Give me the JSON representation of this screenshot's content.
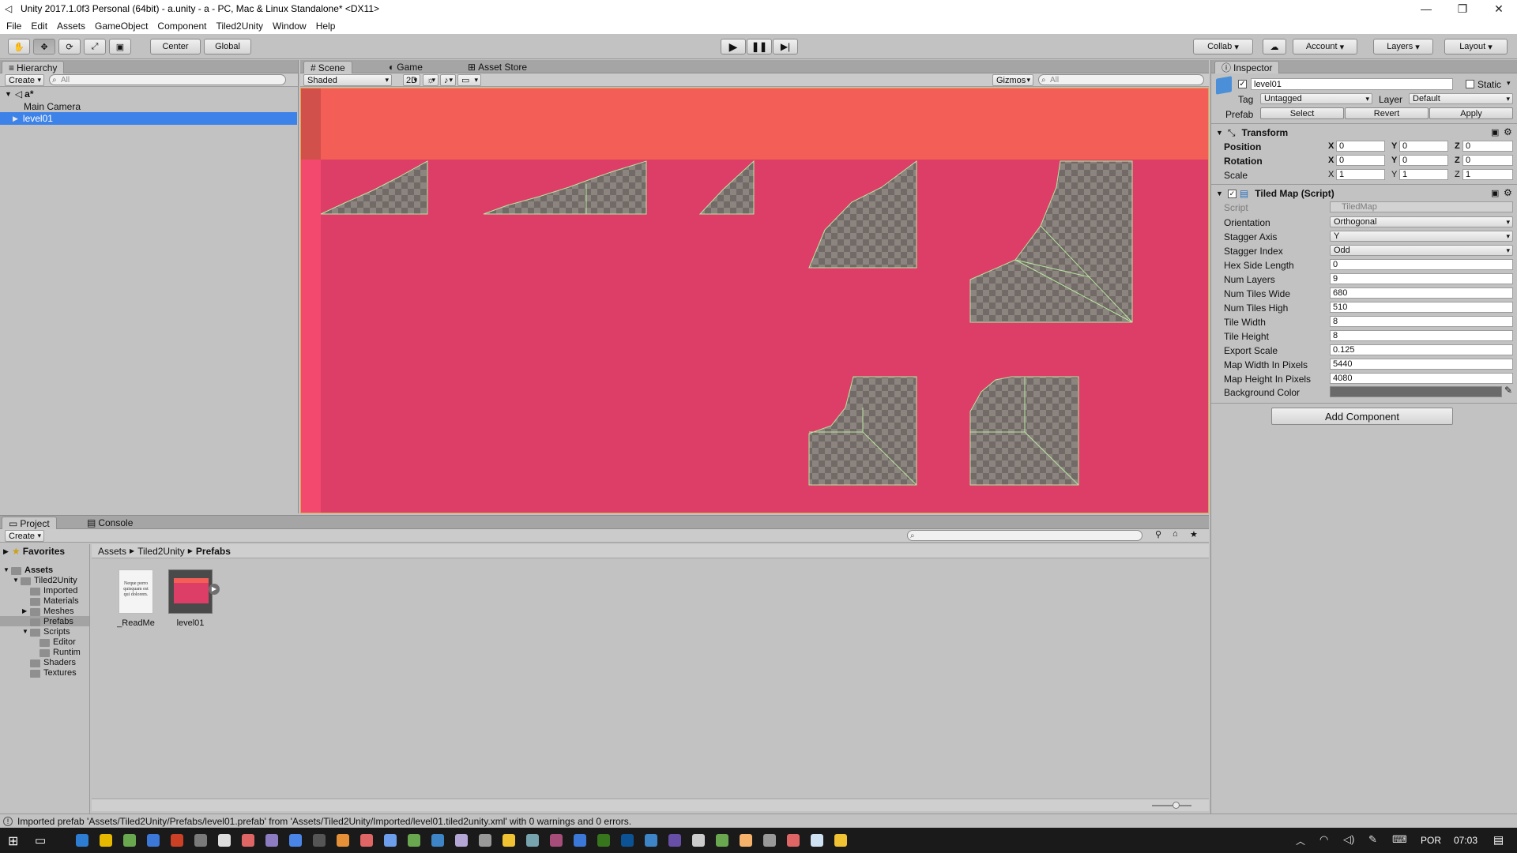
{
  "window": {
    "title": "Unity 2017.1.0f3 Personal (64bit) - a.unity - a - PC, Mac & Linux Standalone* <DX11>",
    "minimize": "—",
    "maximize": "❐",
    "close": "✕"
  },
  "menu": [
    "File",
    "Edit",
    "Assets",
    "GameObject",
    "Component",
    "Tiled2Unity",
    "Window",
    "Help"
  ],
  "toolbar": {
    "pivot": "Center",
    "space": "Global",
    "collab": "Collab",
    "account": "Account",
    "layers": "Layers",
    "layout": "Layout"
  },
  "hierarchy": {
    "tab": "Hierarchy",
    "create": "Create",
    "search_placeholder": "All",
    "scene": "a*",
    "items": [
      "Main Camera",
      "level01"
    ]
  },
  "scene": {
    "tabs": [
      "Scene",
      "Game",
      "Asset Store"
    ],
    "shading": "Shaded",
    "mode2d": "2D",
    "gizmos": "Gizmos",
    "search_placeholder": "All"
  },
  "inspector": {
    "tab": "Inspector",
    "object_name": "level01",
    "static_label": "Static",
    "tag_label": "Tag",
    "tag_value": "Untagged",
    "layer_label": "Layer",
    "layer_value": "Default",
    "prefab_label": "Prefab",
    "prefab_select": "Select",
    "prefab_revert": "Revert",
    "prefab_apply": "Apply",
    "transform": {
      "title": "Transform",
      "rows": [
        {
          "label": "Position",
          "x": "0",
          "y": "0",
          "z": "0"
        },
        {
          "label": "Rotation",
          "x": "0",
          "y": "0",
          "z": "0"
        },
        {
          "label": "Scale",
          "x": "1",
          "y": "1",
          "z": "1"
        }
      ]
    },
    "tiledmap": {
      "title": "Tiled Map (Script)",
      "script_label": "Script",
      "script_value": "TiledMap",
      "rows": [
        {
          "label": "Orientation",
          "value": "Orthogonal",
          "dropdown": true
        },
        {
          "label": "Stagger Axis",
          "value": "Y",
          "dropdown": true
        },
        {
          "label": "Stagger Index",
          "value": "Odd",
          "dropdown": true
        },
        {
          "label": "Hex Side Length",
          "value": "0"
        },
        {
          "label": "Num Layers",
          "value": "9"
        },
        {
          "label": "Num Tiles Wide",
          "value": "680"
        },
        {
          "label": "Num Tiles High",
          "value": "510"
        },
        {
          "label": "Tile Width",
          "value": "8"
        },
        {
          "label": "Tile Height",
          "value": "8"
        },
        {
          "label": "Export Scale",
          "value": "0.125"
        },
        {
          "label": "Map Width In Pixels",
          "value": "5440"
        },
        {
          "label": "Map Height In Pixels",
          "value": "4080"
        }
      ],
      "bg_label": "Background Color",
      "bg_color": "#6a6a6a"
    },
    "add_component": "Add Component"
  },
  "project": {
    "tabs": [
      "Project",
      "Console"
    ],
    "create": "Create",
    "breadcrumb": [
      "Assets",
      "Tiled2Unity",
      "Prefabs"
    ],
    "favorites": "Favorites",
    "tree": [
      {
        "label": "Assets",
        "depth": 0,
        "bold": true
      },
      {
        "label": "Tiled2Unity",
        "depth": 1
      },
      {
        "label": "Imported",
        "depth": 2
      },
      {
        "label": "Materials",
        "depth": 2
      },
      {
        "label": "Meshes",
        "depth": 2
      },
      {
        "label": "Prefabs",
        "depth": 2,
        "selected": true
      },
      {
        "label": "Scripts",
        "depth": 2
      },
      {
        "label": "Editor",
        "depth": 3
      },
      {
        "label": "Runtim",
        "depth": 3
      },
      {
        "label": "Shaders",
        "depth": 2
      },
      {
        "label": "Textures",
        "depth": 2
      }
    ],
    "assets": [
      {
        "name": "_ReadMe",
        "preview_text": "Neque porro quisquam est qui dolorem."
      },
      {
        "name": "level01"
      }
    ]
  },
  "status": "Imported prefab 'Assets/Tiled2Unity/Prefabs/level01.prefab' from 'Assets/Tiled2Unity/Imported/level01.tiled2unity.xml' with 0 warnings and 0 errors.",
  "taskbar": {
    "lang": "POR",
    "time": "07:03"
  },
  "colors": {
    "scene_top": "#f35e56",
    "scene_body": "#dc3e68",
    "scene_left": "#f4496f",
    "tile_gray": "#726a66",
    "selection": "#3d82e8"
  }
}
